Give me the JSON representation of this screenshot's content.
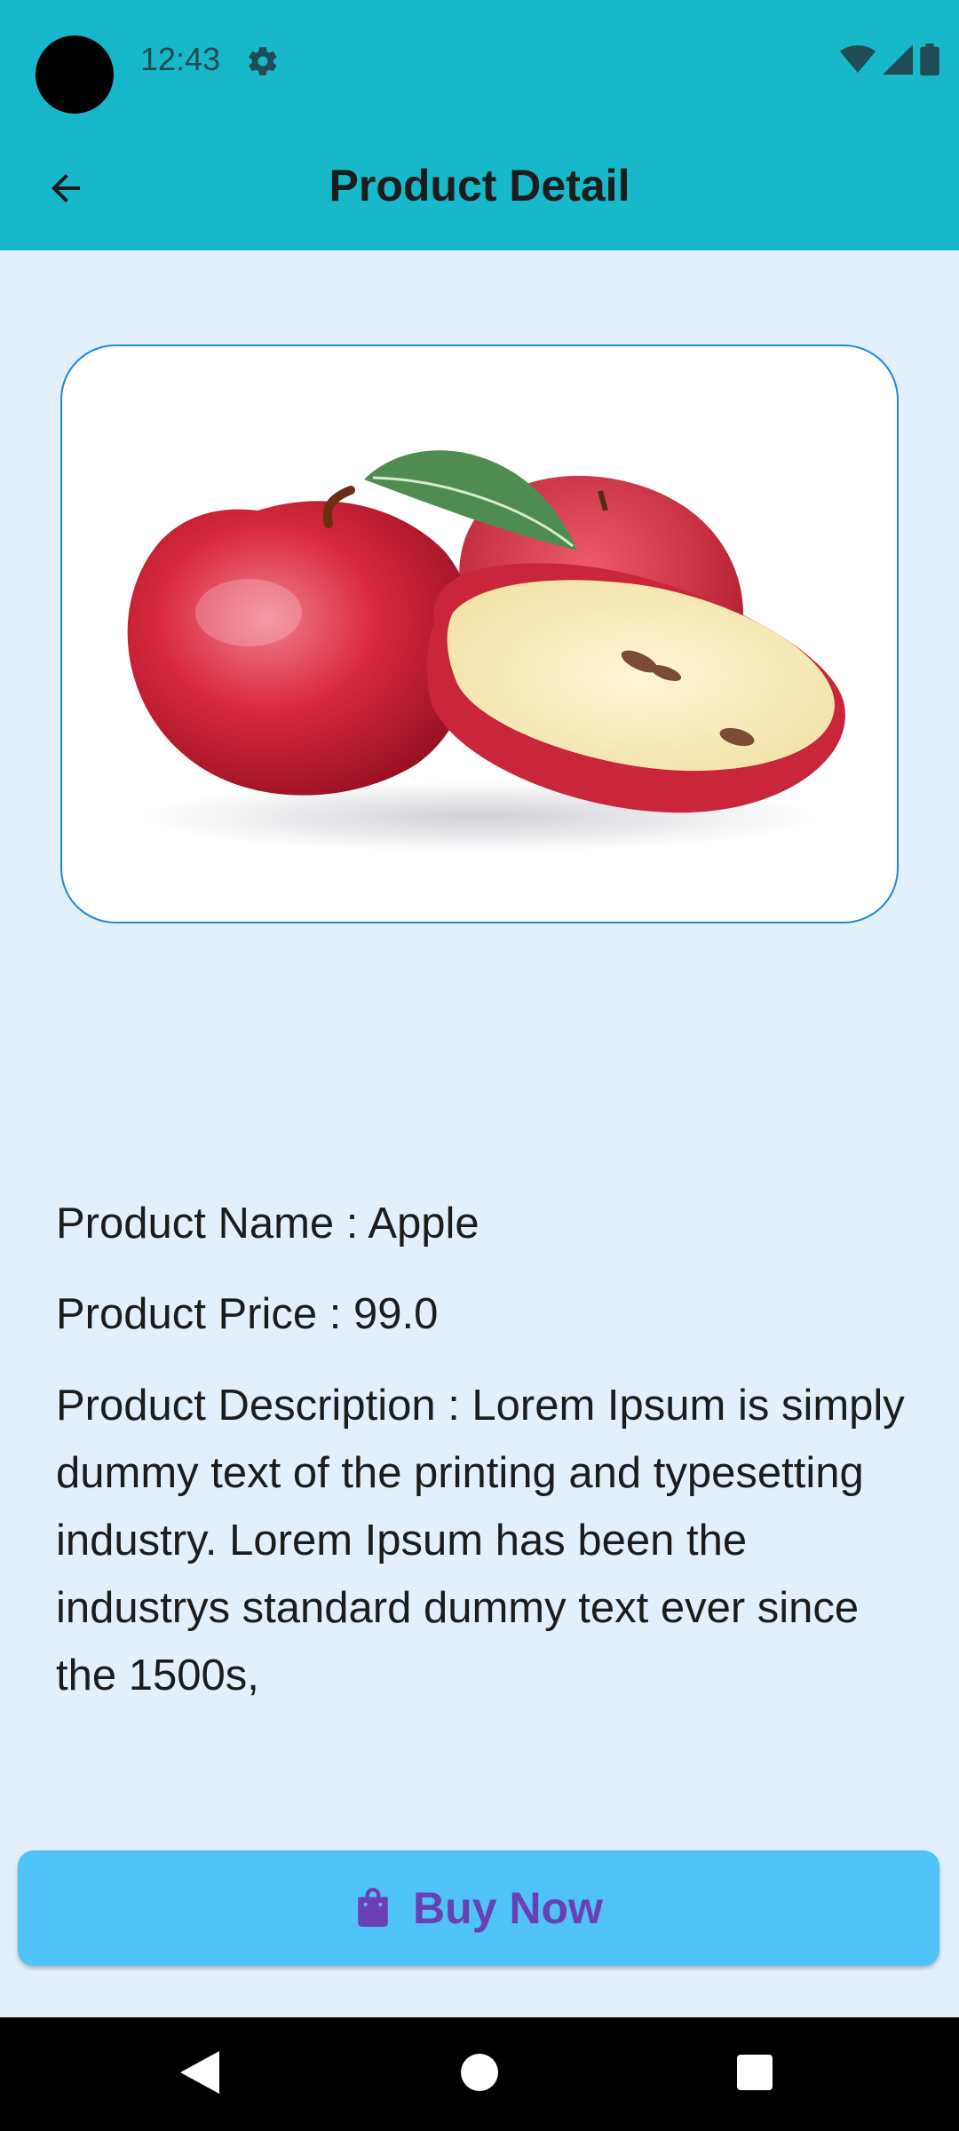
{
  "status_bar": {
    "time": "12:43",
    "icons": [
      "settings-icon",
      "wifi-icon",
      "signal-icon",
      "battery-icon"
    ]
  },
  "app_bar": {
    "title": "Product Detail",
    "back_icon": "arrow-back-icon"
  },
  "product": {
    "image": "apple-image",
    "name_line": "Product Name : Apple",
    "price_line": "Product Price : 99.0",
    "description_line": "Product Description : Lorem Ipsum is simply dummy text of the printing and typesetting industry. Lorem Ipsum has been the industrys standard dummy text ever since the 1500s,"
  },
  "buy_button": {
    "label": "Buy Now",
    "icon": "shopping-bag-icon"
  },
  "navigation": [
    "back-triangle-icon",
    "home-circle-icon",
    "recents-square-icon"
  ],
  "colors": {
    "app_bar": "#16b8c9",
    "background": "#e3f0fb",
    "card_border": "#1e88d6",
    "button": "#4fc3f7",
    "button_text": "#6a3fb5"
  }
}
